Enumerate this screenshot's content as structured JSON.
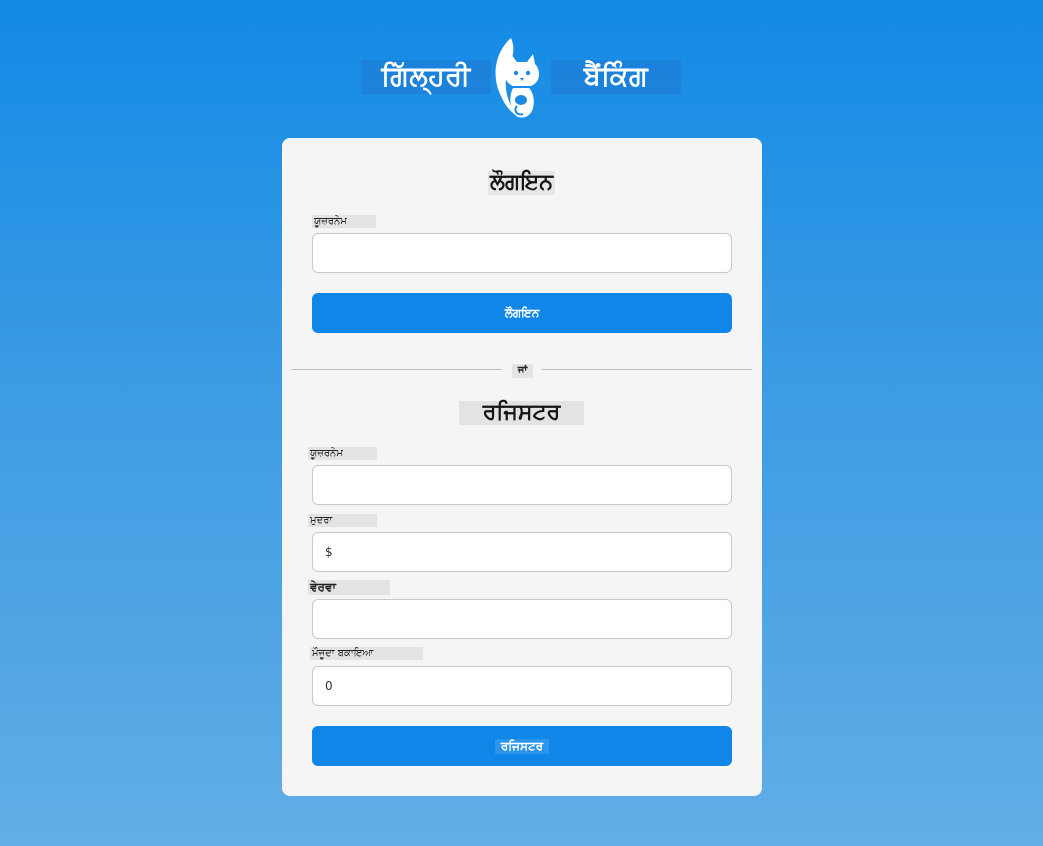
{
  "brand": {
    "left_word": "ਗਿੱਲ੍ਹਰੀ",
    "right_word": "ਬੈਂਕਿੰਗ",
    "logo_icon": "squirrel-logo-icon"
  },
  "login": {
    "title": "ਲੌਗਇਨ",
    "username_label": "ਯੂਜ਼ਰਨੇਮ",
    "username_value": "",
    "button_label": "ਲੌਗਇਨ"
  },
  "divider": {
    "text": "ਜਾਂ"
  },
  "register": {
    "title": "ਰਜਿਸਟਰ",
    "username_label": "ਯੂਜ਼ਰਨੇਮ",
    "username_value": "",
    "currency_label": "ਮੁਦਰਾ",
    "currency_value": "$",
    "description_label": "ਵੇਰਵਾ",
    "description_value": "",
    "balance_label": "ਮੌਜੂਦਾ ਬਕਾਇਆ",
    "balance_value": "0",
    "button_label": "ਰਜਿਸਟਰ"
  },
  "colors": {
    "background_top": "#128ae6",
    "background_bottom": "#62aee5",
    "card": "#f5f5f5",
    "button": "#0f86e8"
  }
}
